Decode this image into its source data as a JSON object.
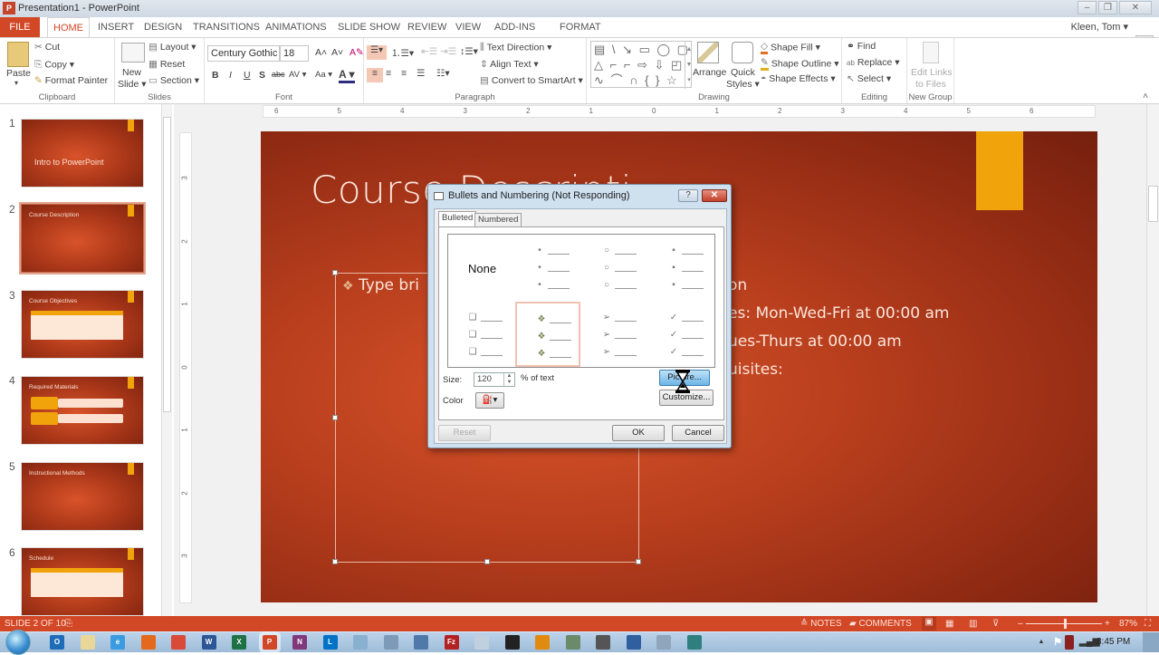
{
  "window": {
    "title": "Presentation1 - PowerPoint",
    "app_icon": "P",
    "controls": {
      "minimize": "–",
      "restore": "❐",
      "close": "✕"
    }
  },
  "tabs": [
    "FILE",
    "HOME",
    "INSERT",
    "DESIGN",
    "TRANSITIONS",
    "ANIMATIONS",
    "SLIDE SHOW",
    "REVIEW",
    "VIEW",
    "ADD-INS",
    "FORMAT"
  ],
  "active_tab": "HOME",
  "user": {
    "name": "Kleen, Tom ▾"
  },
  "ribbon": {
    "clipboard": {
      "label": "Clipboard",
      "paste": "Paste",
      "paste_arrow": "▾",
      "cut": "Cut",
      "copy": "Copy ▾",
      "format_painter": "Format Painter"
    },
    "slides": {
      "label": "Slides",
      "new_slide_1": "New",
      "new_slide_2": "Slide ▾",
      "layout": "Layout ▾",
      "reset": "Reset",
      "section": "Section ▾"
    },
    "font": {
      "label": "Font",
      "font_name": "Century Gothic",
      "font_size": "18",
      "grow": "A˄",
      "shrink": "A˅",
      "clear": "A✎",
      "bold": "B",
      "italic": "I",
      "underline": "U",
      "shadow": "S",
      "strike": "abc",
      "spacing": "AV ▾",
      "case": "Aa ▾",
      "color": "A ▾"
    },
    "paragraph": {
      "label": "Paragraph",
      "text_direction": "Text Direction ▾",
      "align_text": "Align Text ▾",
      "convert_smartart": "Convert to SmartArt ▾"
    },
    "drawing": {
      "label": "Drawing",
      "shapes_row1": "▤ \\ ↘ ▭ ◯ ▢",
      "shapes_row2": "△ ⌐ ⌐ ⇨ ⇩ ◰",
      "shapes_row3": "∿ ⌒ ∩ { } ☆",
      "arrange": "Arrange",
      "quick_styles_1": "Quick",
      "quick_styles_2": "Styles ▾",
      "shape_fill": "Shape Fill ▾",
      "shape_outline": "Shape Outline ▾",
      "shape_effects": "Shape Effects ▾"
    },
    "editing": {
      "label": "Editing",
      "find": "Find",
      "replace": "Replace ▾",
      "select": "Select ▾"
    },
    "new_group": {
      "label": "New Group",
      "edit_links_1": "Edit Links",
      "edit_links_2": "to Files"
    },
    "collapse": "˄"
  },
  "thumbnails": [
    {
      "num": "1",
      "title": "Intro to PowerPoint",
      "selected": false
    },
    {
      "num": "2",
      "title": "Course Description",
      "selected": true
    },
    {
      "num": "3",
      "title": "Course Objectives",
      "selected": false
    },
    {
      "num": "4",
      "title": "Required Materials",
      "selected": false
    },
    {
      "num": "5",
      "title": "Instructional Methods",
      "selected": false
    },
    {
      "num": "6",
      "title": "Schedule",
      "selected": false
    }
  ],
  "ruler": {
    "h_ticks": [
      "6",
      "5",
      "4",
      "3",
      "2",
      "1",
      "0",
      "1",
      "2",
      "3",
      "4",
      "5",
      "6"
    ],
    "v_ticks": [
      "3",
      "2",
      "1",
      "0",
      "1",
      "2",
      "3"
    ]
  },
  "slide": {
    "title": "Course Descripti",
    "left_bullet": "Type bri",
    "right_lines": [
      "on",
      "es: Mon-Wed-Fri at 00:00 am",
      "ues-Thurs at 00:00 am",
      "uisites:",
      ":"
    ],
    "accent_color": "#f0a30a",
    "bg_color": "#b73e1d"
  },
  "dialog": {
    "title": "Bullets and Numbering (Not Responding)",
    "help": "?",
    "close": "✕",
    "tabs": [
      "Bulleted",
      "Numbered"
    ],
    "active_tab": "Bulleted",
    "none_label": "None",
    "bullet_styles": [
      {
        "name": "none"
      },
      {
        "name": "small-dot",
        "glyph": "•"
      },
      {
        "name": "hollow-circle",
        "glyph": "○"
      },
      {
        "name": "square",
        "glyph": "▪"
      },
      {
        "name": "hollow-square",
        "glyph": "❑"
      },
      {
        "name": "diamond-flower",
        "glyph": "❖",
        "selected": true
      },
      {
        "name": "arrowhead",
        "glyph": "➢"
      },
      {
        "name": "checkmark",
        "glyph": "✓"
      }
    ],
    "size_label": "Size:",
    "size_value": "120",
    "size_suffix": "% of text",
    "color_label": "Color",
    "picture_button": "Picture...",
    "customize_button": "Customize...",
    "reset_button": "Reset",
    "ok_button": "OK",
    "cancel_button": "Cancel"
  },
  "statusbar": {
    "slide_info": "SLIDE 2 OF 10",
    "notes": "≙ NOTES",
    "comments": "COMMENTS",
    "zoom_minus": "–",
    "zoom_plus": "+",
    "zoom_level": "87%",
    "zoom_fraction": 0.5
  },
  "taskbar": {
    "apps": [
      {
        "name": "outlook",
        "glyph": "O",
        "color": "#1e6bb8"
      },
      {
        "name": "notes",
        "glyph": "",
        "color": "#e9d79a"
      },
      {
        "name": "ie",
        "glyph": "e",
        "color": "#3b9be0"
      },
      {
        "name": "firefox",
        "glyph": "",
        "color": "#e5691c"
      },
      {
        "name": "chrome",
        "glyph": "",
        "color": "#d94a38"
      },
      {
        "name": "word",
        "glyph": "W",
        "color": "#2b5797"
      },
      {
        "name": "excel",
        "glyph": "X",
        "color": "#1e7145"
      },
      {
        "name": "powerpoint",
        "glyph": "P",
        "color": "#d24726"
      },
      {
        "name": "onenote",
        "glyph": "N",
        "color": "#80397b"
      },
      {
        "name": "lync",
        "glyph": "L",
        "color": "#0072c6"
      },
      {
        "name": "app-11",
        "glyph": "",
        "color": "#8ab0cf"
      },
      {
        "name": "app-12",
        "glyph": "",
        "color": "#7d9bb8"
      },
      {
        "name": "app-13",
        "glyph": "",
        "color": "#4f79a8"
      },
      {
        "name": "filezilla",
        "glyph": "Fz",
        "color": "#b22222"
      },
      {
        "name": "app-15",
        "glyph": "",
        "color": "#c0d0de"
      },
      {
        "name": "terminal",
        "glyph": "",
        "color": "#222222"
      },
      {
        "name": "headset",
        "glyph": "",
        "color": "#e08a10"
      },
      {
        "name": "app-18",
        "glyph": "",
        "color": "#6a8a6a"
      },
      {
        "name": "app-19",
        "glyph": "",
        "color": "#555555"
      },
      {
        "name": "app-20",
        "glyph": "",
        "color": "#2f5f9f"
      },
      {
        "name": "app-21",
        "glyph": "",
        "color": "#8fa5bb"
      },
      {
        "name": "app-22",
        "glyph": "",
        "color": "#2f7f7f"
      }
    ],
    "tray": {
      "up_arrow": "▲",
      "flag": "⚑",
      "clock": "3:45 PM"
    }
  }
}
